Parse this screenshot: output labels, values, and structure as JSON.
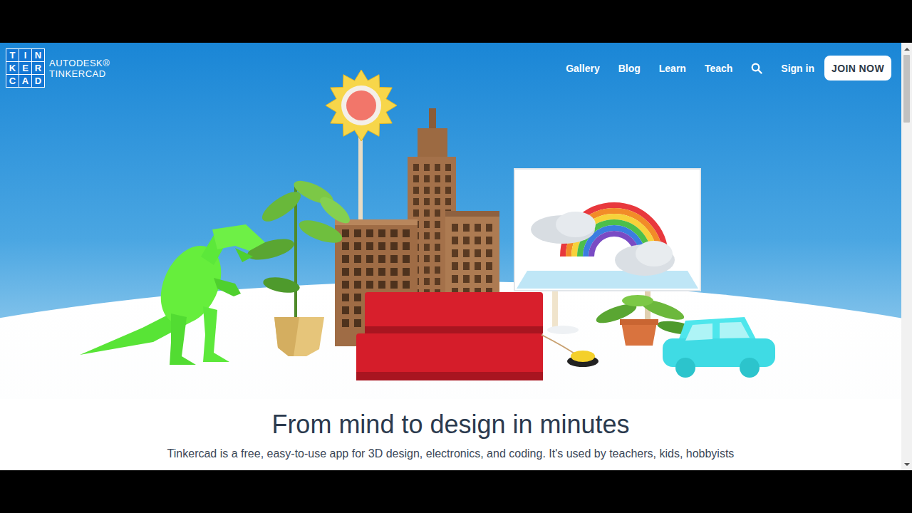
{
  "header": {
    "logo": {
      "letters": [
        "T",
        "I",
        "N",
        "K",
        "E",
        "R",
        "C",
        "A",
        "D"
      ],
      "brand": "AUTODESK®",
      "product": "TINKERCAD"
    },
    "nav": [
      {
        "label": "Gallery"
      },
      {
        "label": "Blog"
      },
      {
        "label": "Learn"
      },
      {
        "label": "Teach"
      }
    ],
    "sign_in": "Sign in",
    "join_button": "JOIN NOW"
  },
  "intro": {
    "heading": "From mind to design in minutes",
    "text": "Tinkercad is a free, easy-to-use app for 3D design, electronics, and coding. It's used by teachers, kids, hobbyists"
  },
  "scrollbar": {
    "position": 0
  }
}
